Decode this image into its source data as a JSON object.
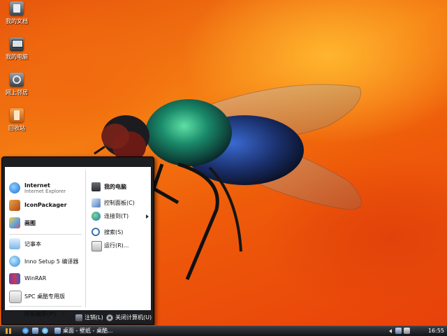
{
  "desktop": {
    "icons": [
      {
        "label": "我的文档",
        "icon": "my-documents-icon"
      },
      {
        "label": "我的电脑",
        "icon": "my-computer-icon"
      },
      {
        "label": "网上邻居",
        "icon": "network-places-icon"
      },
      {
        "label": "回收站",
        "icon": "recycle-bin-icon"
      }
    ]
  },
  "start_menu": {
    "left": {
      "pinned": [
        {
          "title": "Internet",
          "subtitle": "Internet Explorer",
          "icon": "internet-explorer-icon"
        },
        {
          "title": "IconPackager",
          "icon": "iconpackager-icon"
        },
        {
          "title": "画图",
          "icon": "paint-icon"
        }
      ],
      "recent": [
        {
          "title": "记事本",
          "icon": "notepad-icon"
        },
        {
          "title": "Inno Setup 5 编译器",
          "icon": "inno-setup-icon"
        },
        {
          "title": "WinRAR",
          "icon": "winrar-icon"
        },
        {
          "title": "SPC 桌酷专用版",
          "icon": "spc-icon"
        }
      ],
      "all_programs": "所有程序(P)"
    },
    "right": {
      "items": [
        {
          "title": "我的电脑",
          "bold": true,
          "icon": "my-computer-icon"
        },
        {
          "title": "控制面板(C)",
          "icon": "control-panel-icon"
        },
        {
          "title": "连接到(T)",
          "icon": "connect-to-icon",
          "submenu": true
        },
        {
          "title": "搜索(S)",
          "icon": "search-icon"
        },
        {
          "title": "运行(R)...",
          "icon": "run-icon"
        }
      ]
    },
    "footer": {
      "logoff": "注销(L)",
      "shutdown": "关闭计算机(U)"
    }
  },
  "taskbar": {
    "task_label": "桌面 - 壁纸 - 桌酷...",
    "clock": "16:55"
  }
}
